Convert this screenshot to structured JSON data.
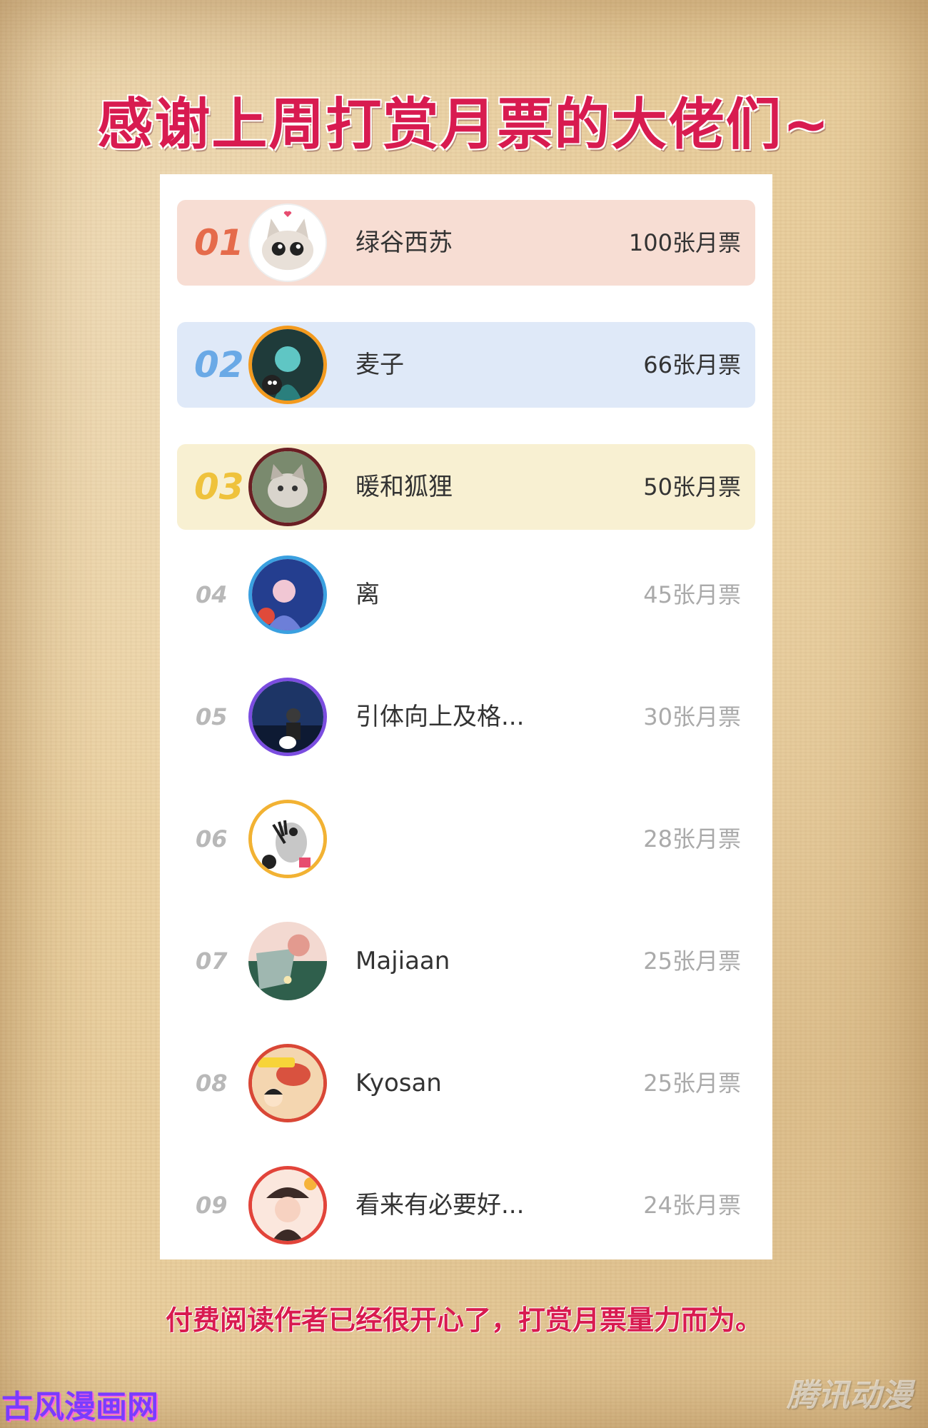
{
  "title": "感谢上周打赏月票的大佬们~",
  "leaderboard": [
    {
      "rank": "01",
      "name": "绿谷西苏",
      "votes": "100张月票"
    },
    {
      "rank": "02",
      "name": "麦子",
      "votes": "66张月票"
    },
    {
      "rank": "03",
      "name": "暖和狐狸",
      "votes": "50张月票"
    },
    {
      "rank": "04",
      "name": "离",
      "votes": "45张月票"
    },
    {
      "rank": "05",
      "name": "引体向上及格...",
      "votes": "30张月票"
    },
    {
      "rank": "06",
      "name": "",
      "votes": "28张月票"
    },
    {
      "rank": "07",
      "name": "Majiaan",
      "votes": "25张月票"
    },
    {
      "rank": "08",
      "name": "Kyosan",
      "votes": "25张月票"
    },
    {
      "rank": "09",
      "name": "看来有必要好...",
      "votes": "24张月票"
    }
  ],
  "footer": "付费阅读作者已经很开心了，打赏月票量力而为。",
  "watermarks": {
    "left": "古风漫画网",
    "right": "腾讯动漫"
  },
  "colors": {
    "title": "#d81b50",
    "rank1_bg": "#f7ddd3",
    "rank2_bg": "#dfe9f8",
    "rank3_bg": "#f8f0d2",
    "rank1_num": "#e56b4b",
    "rank2_num": "#6aa9e6",
    "rank3_num": "#efc23c"
  },
  "avatars": [
    "cat-face-avatar",
    "anime-girl-avatar",
    "cat-photo-avatar",
    "anime-portrait-avatar",
    "person-photo-avatar",
    "cartoon-bird-avatar",
    "flower-avatar",
    "cartoon-boy-avatar",
    "anime-girl-hat-avatar"
  ]
}
